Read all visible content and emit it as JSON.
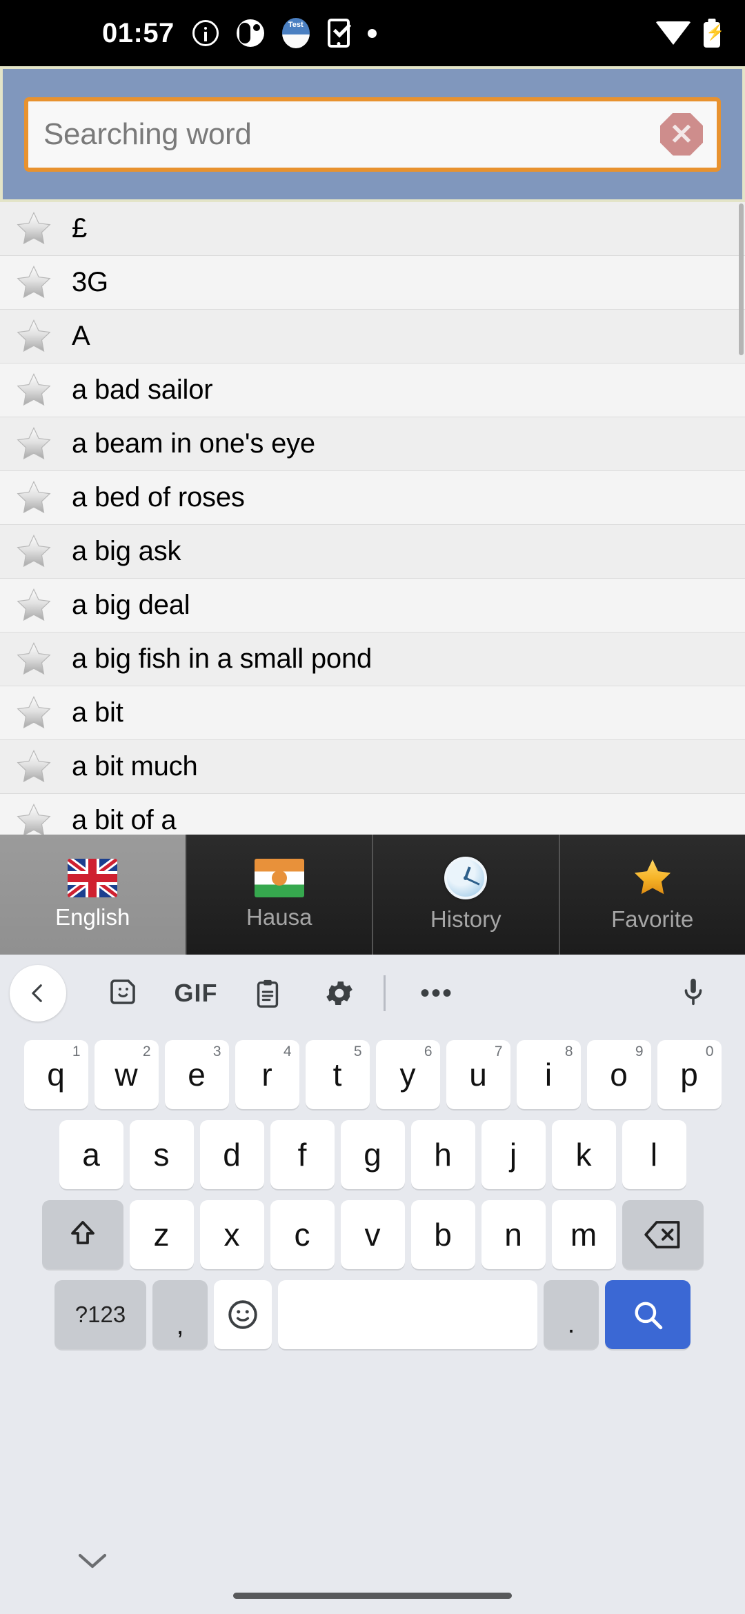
{
  "status_bar": {
    "time": "01:57",
    "icons_left": [
      "info-icon",
      "app-badge-icon",
      "test-app-icon",
      "phone-check-icon",
      "dot-icon"
    ],
    "icons_right": [
      "wifi-icon",
      "battery-charging-icon"
    ]
  },
  "header": {
    "search": {
      "placeholder": "Searching word",
      "value": "",
      "clear_label": "✕"
    },
    "colors": {
      "bar_bg": "#8097bd",
      "bar_border": "#e3e4c8",
      "field_border": "#e8922f",
      "field_bg": "#f8f8f8"
    }
  },
  "word_list": {
    "items": [
      {
        "label": "£",
        "favorite": false
      },
      {
        "label": "3G",
        "favorite": false
      },
      {
        "label": "A",
        "favorite": false
      },
      {
        "label": "a bad sailor",
        "favorite": false
      },
      {
        "label": "a beam in one's eye",
        "favorite": false
      },
      {
        "label": "a bed of roses",
        "favorite": false
      },
      {
        "label": "a big ask",
        "favorite": false
      },
      {
        "label": "a big deal",
        "favorite": false
      },
      {
        "label": "a big fish in a small pond",
        "favorite": false
      },
      {
        "label": "a bit",
        "favorite": false
      },
      {
        "label": "a bit much",
        "favorite": false
      },
      {
        "label": "a bit of a",
        "favorite": false
      }
    ]
  },
  "tabs": {
    "active_index": 0,
    "items": [
      {
        "label": "English",
        "icon": "uk-flag-icon"
      },
      {
        "label": "Hausa",
        "icon": "niger-flag-icon"
      },
      {
        "label": "History",
        "icon": "clock-icon"
      },
      {
        "label": "Favorite",
        "icon": "gold-star-icon"
      }
    ]
  },
  "keyboard": {
    "toolbar": [
      {
        "name": "back-chevron-icon"
      },
      {
        "name": "sticker-icon"
      },
      {
        "name": "gif-icon",
        "label": "GIF"
      },
      {
        "name": "clipboard-icon"
      },
      {
        "name": "settings-gear-icon"
      },
      {
        "name": "more-options-icon",
        "label": "•••"
      },
      {
        "name": "microphone-icon"
      }
    ],
    "row1": [
      {
        "key": "q",
        "hint": "1"
      },
      {
        "key": "w",
        "hint": "2"
      },
      {
        "key": "e",
        "hint": "3"
      },
      {
        "key": "r",
        "hint": "4"
      },
      {
        "key": "t",
        "hint": "5"
      },
      {
        "key": "y",
        "hint": "6"
      },
      {
        "key": "u",
        "hint": "7"
      },
      {
        "key": "i",
        "hint": "8"
      },
      {
        "key": "o",
        "hint": "9"
      },
      {
        "key": "p",
        "hint": "0"
      }
    ],
    "row2": [
      {
        "key": "a"
      },
      {
        "key": "s"
      },
      {
        "key": "d"
      },
      {
        "key": "f"
      },
      {
        "key": "g"
      },
      {
        "key": "h"
      },
      {
        "key": "j"
      },
      {
        "key": "k"
      },
      {
        "key": "l"
      }
    ],
    "row3": [
      {
        "key": "z"
      },
      {
        "key": "x"
      },
      {
        "key": "c"
      },
      {
        "key": "v"
      },
      {
        "key": "b"
      },
      {
        "key": "n"
      },
      {
        "key": "m"
      }
    ],
    "shift_label": "shift-key-icon",
    "backspace_label": "backspace-key-icon",
    "row4": {
      "symbols": "?123",
      "comma": ",",
      "emoji": "emoji-smiley-icon",
      "space": "",
      "period": ".",
      "enter": "search-icon"
    },
    "accent": "#3b68d4"
  },
  "nav_bar": {
    "hide_keyboard": "chevron-down-icon",
    "home_indicator": "home-gesture-bar"
  }
}
